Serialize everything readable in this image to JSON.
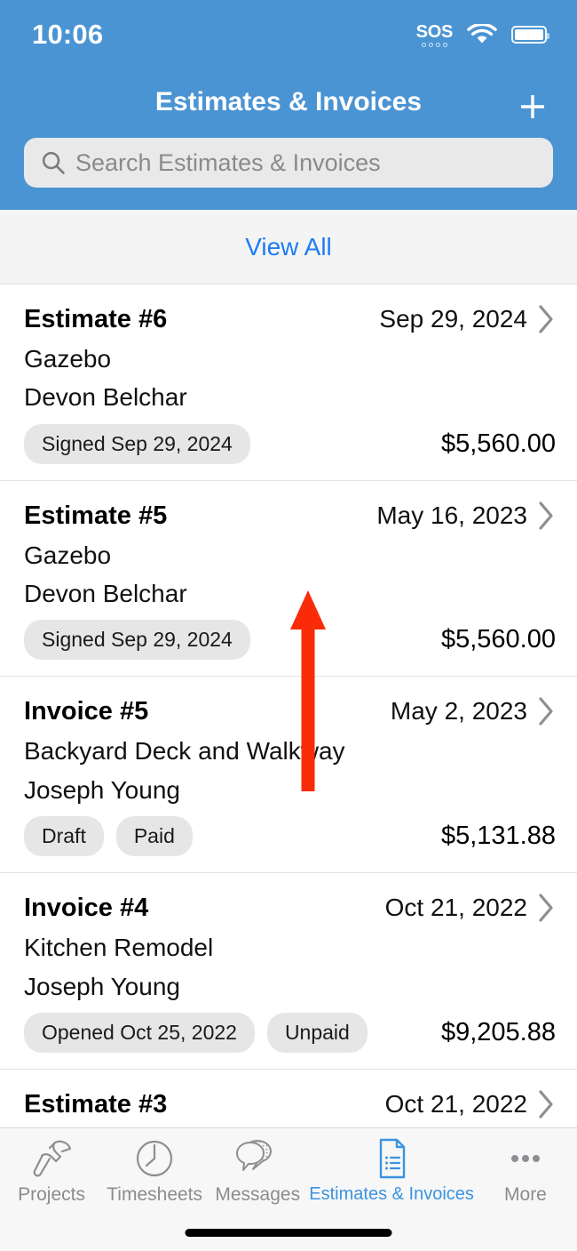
{
  "status_bar": {
    "time": "10:06",
    "sos_label": "SOS",
    "wifi_icon": "wifi-icon",
    "battery_icon": "battery-icon"
  },
  "header": {
    "title": "Estimates & Invoices",
    "add_icon": "plus-icon",
    "background_color": "#4a94d4"
  },
  "search": {
    "placeholder": "Search Estimates & Invoices",
    "value": "",
    "icon": "search-icon"
  },
  "view_all": {
    "label": "View All",
    "color": "#1c7cf2"
  },
  "list": {
    "items": [
      {
        "title": "Estimate #6",
        "date": "Sep 29, 2024",
        "project": "Gazebo",
        "client": "Devon Belchar",
        "badges": [
          "Signed Sep 29, 2024"
        ],
        "amount": "$5,560.00"
      },
      {
        "title": "Estimate #5",
        "date": "May 16, 2023",
        "project": "Gazebo",
        "client": "Devon Belchar",
        "badges": [
          "Signed Sep 29, 2024"
        ],
        "amount": "$5,560.00"
      },
      {
        "title": "Invoice #5",
        "date": "May 2, 2023",
        "project": "Backyard Deck and Walkway",
        "client": "Joseph Young",
        "badges": [
          "Draft",
          "Paid"
        ],
        "amount": "$5,131.88"
      },
      {
        "title": "Invoice #4",
        "date": "Oct 21, 2022",
        "project": "Kitchen Remodel",
        "client": "Joseph Young",
        "badges": [
          "Opened Oct 25, 2022",
          "Unpaid"
        ],
        "amount": "$9,205.88"
      },
      {
        "title": "Estimate #3",
        "date": "Oct 21, 2022",
        "project": "",
        "client": "",
        "badges": [],
        "amount": ""
      }
    ],
    "chevron_icon": "chevron-right-icon"
  },
  "annotation": {
    "type": "arrow-up",
    "color": "#fa2b09"
  },
  "tabbar": {
    "items": [
      {
        "label": "Projects",
        "icon": "hammer-icon",
        "active": false
      },
      {
        "label": "Timesheets",
        "icon": "clock-icon",
        "active": false
      },
      {
        "label": "Messages",
        "icon": "speech-bubbles-icon",
        "active": false
      },
      {
        "label": "Estimates & Invoices",
        "icon": "document-list-icon",
        "active": true
      },
      {
        "label": "More",
        "icon": "ellipsis-icon",
        "active": false
      }
    ],
    "active_color": "#3b93e0",
    "inactive_color": "#8c8c8c"
  }
}
